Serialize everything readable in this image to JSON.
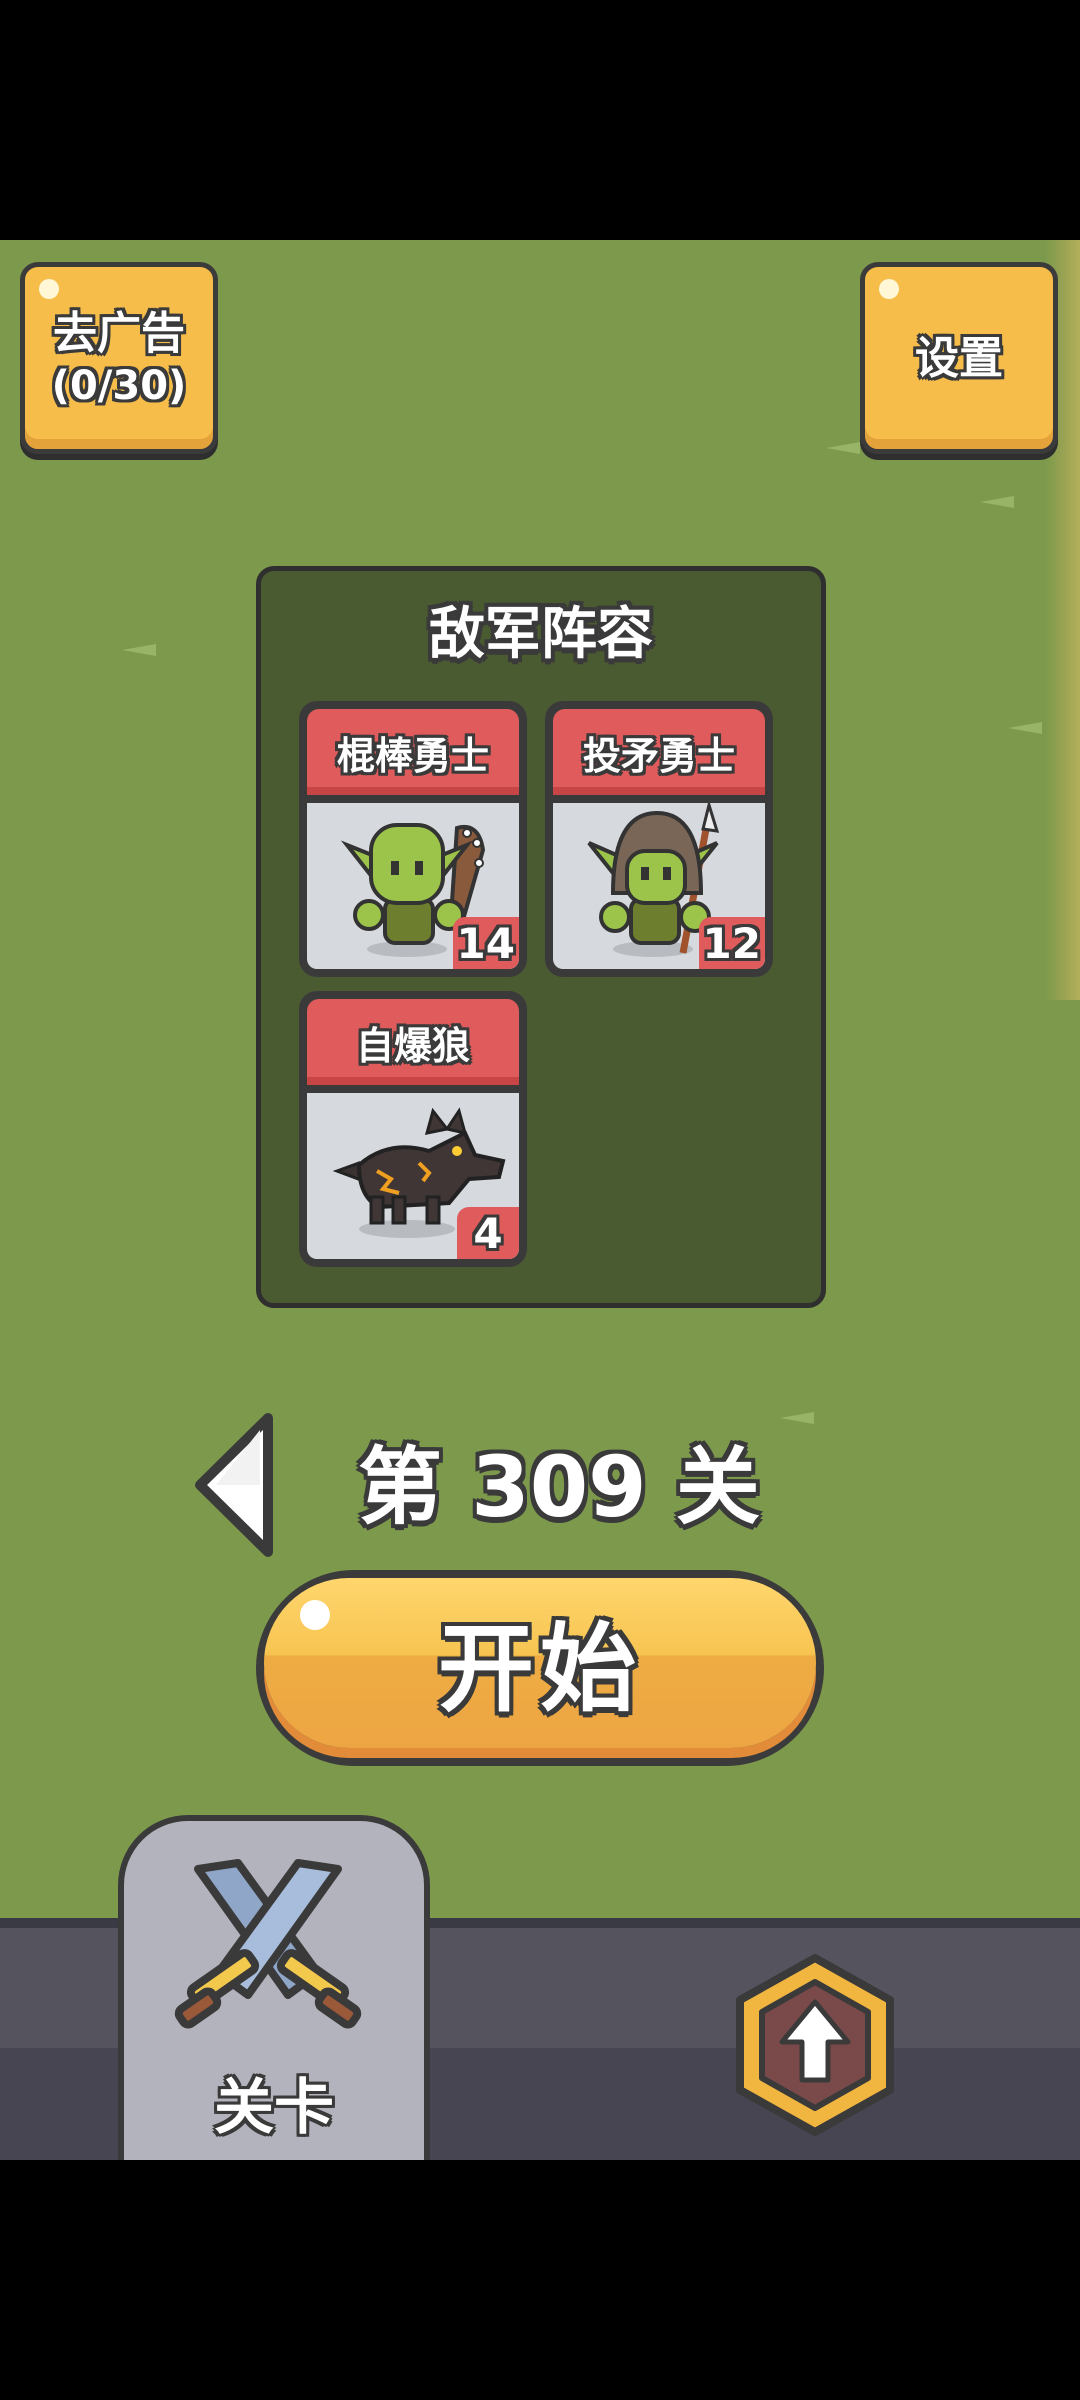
{
  "top_left_button": {
    "title": "去广告",
    "subtitle": "(0/30)"
  },
  "top_right_button": {
    "label": "设置"
  },
  "enemy_panel": {
    "title": "敌军阵容",
    "units": [
      {
        "name": "棍棒勇士",
        "count": "14",
        "icon": "goblin-club-icon"
      },
      {
        "name": "投矛勇士",
        "count": "12",
        "icon": "goblin-spear-icon"
      },
      {
        "name": "自爆狼",
        "count": "4",
        "icon": "explosive-wolf-icon"
      }
    ]
  },
  "level": {
    "text": "第 309 关"
  },
  "start_button": {
    "label": "开始"
  },
  "bottom_nav": {
    "active_tab": {
      "label": "关卡",
      "icon": "crossed-swords-icon"
    },
    "upgrade_icon": "upgrade-arrow-icon"
  },
  "colors": {
    "grass": "#7d9a4c",
    "panel": "#4a5a31",
    "button_yellow": "#f7bd4b",
    "card_red": "#e05b5b",
    "outline": "#3a3a3a"
  }
}
